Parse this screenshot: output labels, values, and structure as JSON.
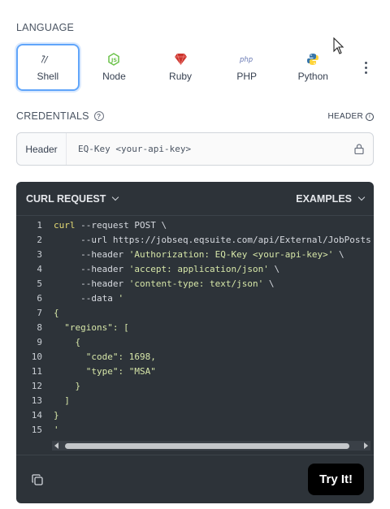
{
  "language": {
    "label": "LANGUAGE",
    "tabs": [
      {
        "name": "Shell",
        "icon": "shell-icon",
        "active": true
      },
      {
        "name": "Node",
        "icon": "nodejs-icon",
        "active": false
      },
      {
        "name": "Ruby",
        "icon": "ruby-icon",
        "active": false
      },
      {
        "name": "PHP",
        "icon": "php-icon",
        "active": false
      },
      {
        "name": "Python",
        "icon": "python-icon",
        "active": false
      }
    ]
  },
  "credentials": {
    "label": "CREDENTIALS",
    "header_toggle": "HEADER",
    "field_label": "Header",
    "value": "EQ-Key <your-api-key>"
  },
  "request": {
    "title": "CURL REQUEST",
    "examples_label": "EXAMPLES",
    "line_numbers": [
      "1",
      "2",
      "3",
      "4",
      "5",
      "6",
      "7",
      "8",
      "9",
      "10",
      "11",
      "12",
      "13",
      "14",
      "15"
    ],
    "code": {
      "l1_cmd": "curl",
      "l1_rest": " --request POST \\",
      "l2_flag": "     --url",
      "l2_rest": " https://jobseq.eqsuite.com/api/External/JobPosts",
      "l3_flag": "     --header",
      "l3_str": " 'Authorization: EQ-Key <your-api-key>'",
      "l3_end": " \\",
      "l4_flag": "     --header",
      "l4_str": " 'accept: application/json'",
      "l4_end": " \\",
      "l5_flag": "     --header",
      "l5_str": " 'content-type: text/json'",
      "l5_end": " \\",
      "l6_flag": "     --data",
      "l6_str": " '",
      "l7": "{",
      "l8_key": "  \"regions\"",
      "l8_rest": ": [",
      "l9": "    {",
      "l10_key": "      \"code\"",
      "l10_sep": ": ",
      "l10_val": "1698",
      "l10_end": ",",
      "l11_key": "      \"type\"",
      "l11_sep": ": ",
      "l11_val": "\"MSA\"",
      "l12": "    }",
      "l13": "  ]",
      "l14": "}",
      "l15": "'"
    },
    "try_label": "Try It!"
  }
}
